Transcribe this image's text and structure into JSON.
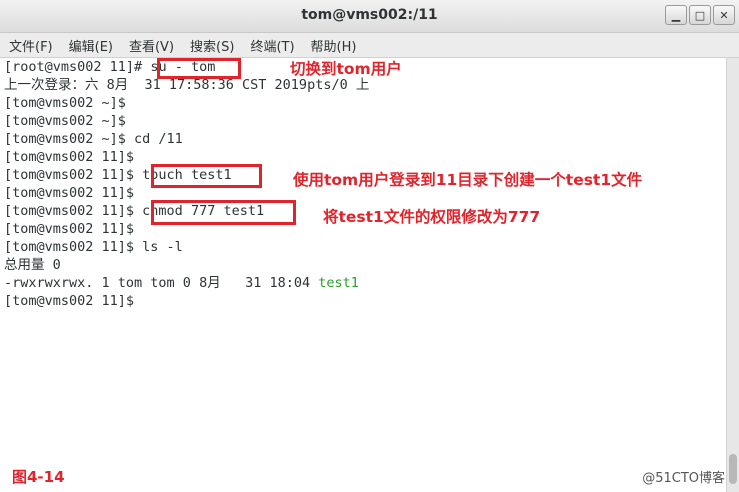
{
  "window": {
    "title": "tom@vms002:/11",
    "minimize_label": "▁",
    "maximize_label": "□",
    "close_label": "✕"
  },
  "menu": [
    {
      "label": "文件(F)"
    },
    {
      "label": "编辑(E)"
    },
    {
      "label": "查看(V)"
    },
    {
      "label": "搜索(S)"
    },
    {
      "label": "终端(T)"
    },
    {
      "label": "帮助(H)"
    }
  ],
  "terminal": {
    "lines": [
      {
        "prompt": "[root@vms002 11]# ",
        "command": "su - tom"
      },
      {
        "text": "上一次登录：六 8月  31 17:58:36 CST 2019pts/0 上"
      },
      {
        "prompt": "[tom@vms002 ~]$ ",
        "command": ""
      },
      {
        "prompt": "[tom@vms002 ~]$ ",
        "command": ""
      },
      {
        "prompt": "[tom@vms002 ~]$ ",
        "command": "cd /11"
      },
      {
        "prompt": "[tom@vms002 11]$ ",
        "command": ""
      },
      {
        "prompt": "[tom@vms002 11]$ ",
        "command": "touch test1"
      },
      {
        "prompt": "[tom@vms002 11]$ ",
        "command": ""
      },
      {
        "prompt": "[tom@vms002 11]$ ",
        "command": "chmod 777 test1"
      },
      {
        "prompt": "[tom@vms002 11]$ ",
        "command": ""
      },
      {
        "prompt": "[tom@vms002 11]$ ",
        "command": "ls -l"
      },
      {
        "text": "总用量 0"
      },
      {
        "text": "-rwxrwxrwx. 1 tom tom 0 8月   31 18:04 ",
        "highlight": "test1"
      },
      {
        "prompt": "[tom@vms002 11]$ ",
        "command": ""
      }
    ]
  },
  "annotations": {
    "su": "切换到tom用户",
    "touch": "使用tom用户登录到11目录下创建一个test1文件",
    "chmod": "将test1文件的权限修改为777"
  },
  "figure_label": "图4-14",
  "watermark": "@51CTO博客",
  "colors": {
    "annotation": "#e0242c",
    "file_highlight": "#2aa02a",
    "terminal_text": "#2e3436"
  }
}
